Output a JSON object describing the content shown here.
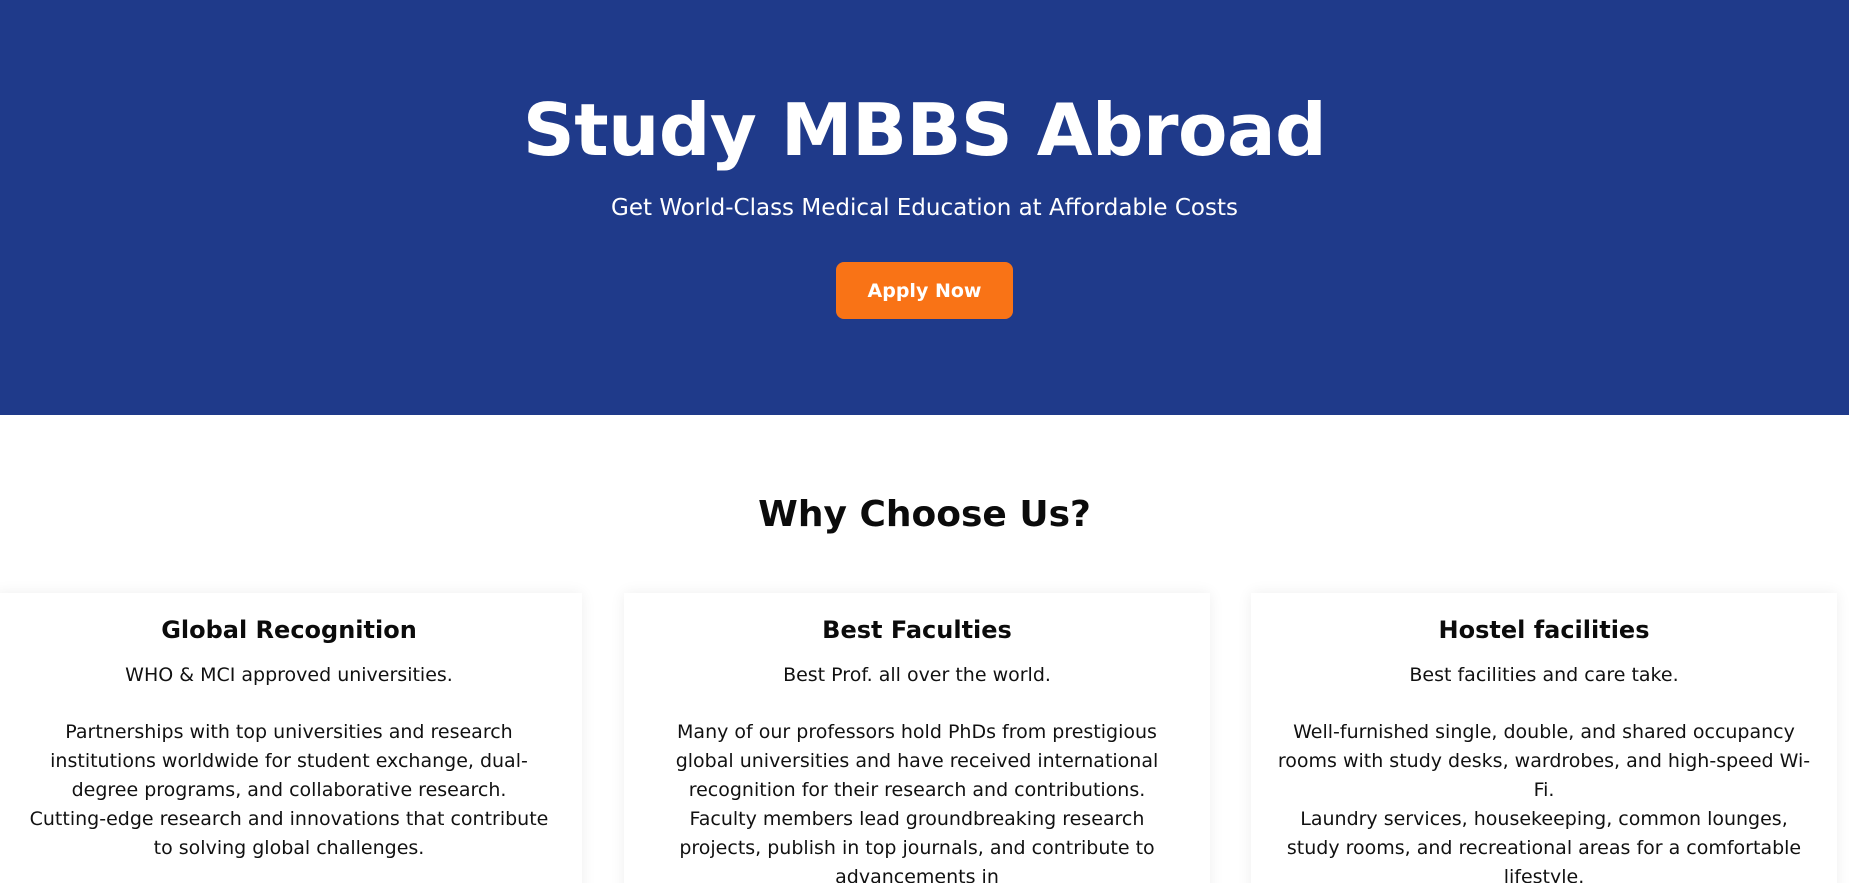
{
  "hero": {
    "title": "Study MBBS Abroad",
    "subtitle": "Get World-Class Medical Education at Affordable Costs",
    "cta_label": "Apply Now",
    "background_color": "#1f3a8a",
    "cta_color": "#f97316"
  },
  "why": {
    "title": "Why Choose Us?",
    "cards": [
      {
        "title": "Global Recognition",
        "lead": "WHO & MCI approved universities.",
        "body": [
          "Partnerships with top universities and research institutions worldwide for student exchange, dual-degree programs, and collaborative research.",
          "Cutting-edge research and innovations that contribute to solving global challenges."
        ]
      },
      {
        "title": "Best Faculties",
        "lead": "Best Prof. all over the world.",
        "body": [
          "Many of our professors hold PhDs from prestigious global universities and have received international recognition for their research and contributions.",
          "Faculty members lead groundbreaking research projects, publish in top journals, and contribute to advancements in"
        ]
      },
      {
        "title": "Hostel facilities",
        "lead": "Best facilities and care take.",
        "body": [
          "Well-furnished single, double, and shared occupancy rooms with study desks, wardrobes, and high-speed Wi-Fi.",
          "Laundry services, housekeeping, common lounges, study rooms, and recreational areas for a comfortable lifestyle."
        ]
      }
    ]
  }
}
